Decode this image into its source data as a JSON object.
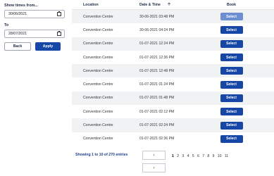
{
  "filter": {
    "from_label": "Show times from...",
    "from_value": "30/06/2021",
    "to_label": "To",
    "to_value": "28/07/2021",
    "back_label": "Back",
    "apply_label": "Apply"
  },
  "table": {
    "headers": {
      "location": "Location",
      "datetime": "Date & Time",
      "book": "Book"
    },
    "sort_icon": "arrow-up-icon",
    "select_label": "Select",
    "rows": [
      {
        "location": "Convention Centre",
        "datetime": "30-06-2021 03:48 PM",
        "disabled": true
      },
      {
        "location": "Convention Centre",
        "datetime": "30-06-2021 04:24 PM",
        "disabled": false
      },
      {
        "location": "Convention Centre",
        "datetime": "01-07-2021 12:24 PM",
        "disabled": false
      },
      {
        "location": "Convention Centre",
        "datetime": "01-07-2021 12:36 PM",
        "disabled": false
      },
      {
        "location": "Convention Centre",
        "datetime": "01-07-2021 12:48 PM",
        "disabled": false
      },
      {
        "location": "Convention Centre",
        "datetime": "01-07-2021 01:24 PM",
        "disabled": false
      },
      {
        "location": "Convention Centre",
        "datetime": "01-07-2021 01:48 PM",
        "disabled": false
      },
      {
        "location": "Convention Centre",
        "datetime": "01-07-2021 02:12 PM",
        "disabled": false
      },
      {
        "location": "Convention Centre",
        "datetime": "01-07-2021 02:24 PM",
        "disabled": false
      },
      {
        "location": "Convention Centre",
        "datetime": "01-07-2021 02:36 PM",
        "disabled": false
      }
    ]
  },
  "pagination": {
    "info": "Showing 1 to 10 of 270 entries",
    "prev_label": "‹",
    "next_label": "›",
    "pages": [
      "1",
      "2",
      "3",
      "4",
      "5",
      "6",
      "7",
      "8",
      "9",
      "10",
      "11"
    ],
    "current": "1"
  },
  "colors": {
    "primary": "#1747a6",
    "disabled": "#6d8fd1",
    "stripe": "#f1f2f4"
  }
}
